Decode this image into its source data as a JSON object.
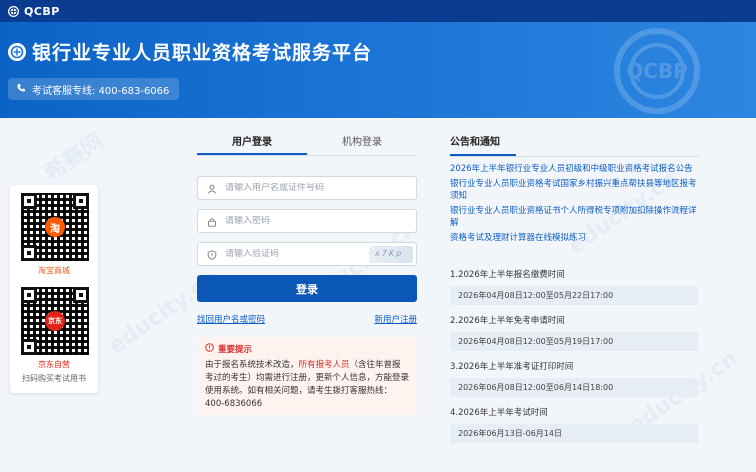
{
  "topbar": {
    "brand": "QCBP"
  },
  "banner": {
    "title": "银行业专业人员职业资格考试服务平台",
    "hotline": "考试客服专线: 400-683-6066",
    "watermark_logo": "QCBP"
  },
  "qr": {
    "taobao_label": "淘宝商城",
    "taobao_badge": "淘",
    "jd_label": "京东自营",
    "jd_badge": "京东",
    "caption": "扫码购买考试用书"
  },
  "login": {
    "tabs": [
      {
        "label": "用户登录"
      },
      {
        "label": "机构登录"
      }
    ],
    "username_placeholder": "请输入用户名或证件号码",
    "password_placeholder": "请输入密码",
    "captcha_placeholder": "请输入验证码",
    "submit_label": "登录",
    "forgot_link": "找回用户名或密码",
    "register_link": "新用户注册"
  },
  "notice": {
    "title": "重要提示",
    "text_before": "由于报名系统技术改造，",
    "highlight": "所有报考人员",
    "text_after": "（含往年曾报考过的考生）均需进行注册，更新个人信息，方能登录使用系统。如有相关问题，请考生拨打客服热线：400-6836066"
  },
  "news": {
    "heading": "公告和通知",
    "links": [
      "2026年上半年银行业专业人员初级和中级职业资格考试报名公告",
      "银行业专业人员职业资格考试国家乡村振兴重点帮扶县等地区报考须知",
      "银行业专业人员职业资格证书个人所得税专项附加扣除操作流程详解",
      "资格考试及理财计算器在线模拟练习"
    ],
    "schedule": [
      {
        "title": "1.2026年上半年报名缴费时间",
        "date": "2026年04月08日12:00至05月22日17:00"
      },
      {
        "title": "2.2026年上半年免考申请时间",
        "date": "2026年04月08日12:00至05月19日17:00"
      },
      {
        "title": "3.2026年上半年准考证打印时间",
        "date": "2026年06月08日12:00至06月14日18:00"
      },
      {
        "title": "4.2026年上半年考试时间",
        "date": "2026年06月13日-06月14日"
      }
    ]
  },
  "colors": {
    "primary": "#0b57b8",
    "banner": "#1a73d5",
    "alert": "#d9302c",
    "topbar": "#0a3d91"
  }
}
